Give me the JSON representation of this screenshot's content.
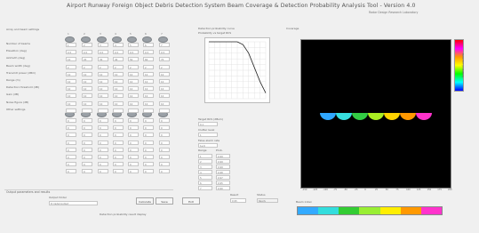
{
  "window": {
    "title": "Airport Runway Foreign Object Debris Detection System Beam Coverage & Detection Probability Analysis Tool - Version 4.0",
    "subtitle": "Radar Design Research Laboratory"
  },
  "left_panel": {
    "header": "Array and beam settings",
    "rows": [
      {
        "label": "Number of beams",
        "values": [
          "1",
          "2",
          "3",
          "4",
          "5",
          "6",
          "7",
          "8"
        ]
      },
      {
        "label": "Elevation (deg)",
        "values": [
          "0.5",
          "0.5",
          "0.5",
          "0.5",
          "0.5",
          "0.5",
          "0.5",
          "0.5"
        ]
      },
      {
        "label": "Azimuth (deg)",
        "values": [
          "10",
          "20",
          "30",
          "40",
          "50",
          "60",
          "70",
          "80"
        ]
      },
      {
        "label": "Beam width (deg)",
        "values": [
          "2",
          "2",
          "2",
          "2",
          "2",
          "2",
          "2",
          "2"
        ]
      },
      {
        "label": "Transmit power (dBm)",
        "values": [
          "10",
          "10",
          "10",
          "10",
          "10",
          "10",
          "10",
          "10"
        ]
      },
      {
        "label": "Range (m)",
        "values": [
          "10",
          "10",
          "10",
          "10",
          "10",
          "10",
          "10",
          "10"
        ]
      },
      {
        "label": "Detection threshold (dB)",
        "values": [
          "10",
          "10",
          "10",
          "10",
          "10",
          "10",
          "10",
          "10"
        ]
      },
      {
        "label": "Gain (dB)",
        "values": [
          "10",
          "10",
          "10",
          "10",
          "10",
          "10",
          "10",
          "10"
        ]
      },
      {
        "label": "Noise figure (dB)",
        "values": [
          "10",
          "10",
          "10",
          "10",
          "10",
          "10",
          "10",
          "10"
        ]
      },
      {
        "label": "Other settings",
        "values": [
          "",
          "",
          "",
          "",
          "",
          "",
          "",
          ""
        ]
      }
    ],
    "bottom_rows": [
      {
        "label": "",
        "values": [
          "0",
          "0",
          "0",
          "0",
          "0",
          "0",
          "0",
          "0"
        ]
      },
      {
        "label": "",
        "values": [
          "0",
          "0",
          "0",
          "0",
          "0",
          "0",
          "0",
          "0"
        ]
      },
      {
        "label": "",
        "values": [
          "0",
          "0",
          "0",
          "0",
          "0",
          "0",
          "0",
          "0"
        ]
      },
      {
        "label": "",
        "values": [
          "0",
          "0",
          "0",
          "0",
          "0",
          "0",
          "0",
          "0"
        ]
      },
      {
        "label": "",
        "values": [
          "0",
          "0",
          "0",
          "0",
          "0",
          "0",
          "0",
          "0"
        ]
      },
      {
        "label": "",
        "values": [
          "0",
          "0",
          "0",
          "0",
          "0",
          "0",
          "0",
          "0"
        ]
      },
      {
        "label": "",
        "values": [
          "0",
          "0",
          "0",
          "0",
          "0",
          "0",
          "0",
          "0"
        ]
      },
      {
        "label": "",
        "values": [
          "0",
          "0",
          "0",
          "0",
          "0",
          "0",
          "0",
          "0"
        ]
      }
    ],
    "col_headers": [
      "1",
      "2",
      "3",
      "4",
      "5",
      "6",
      "7",
      "8"
    ]
  },
  "bottom_left": {
    "section_label": "Output parameters and results",
    "path_label": "Output folder",
    "path_value": "D:\\radar\\output",
    "note": "Detection probability result display"
  },
  "buttons": {
    "calculate": "Calculate",
    "save": "Save",
    "exit": "Exit"
  },
  "middle": {
    "header": "Detection probability curve",
    "subheader": "Probability vs target RCS",
    "field_labels": [
      "Target RCS (dBsm)",
      "Clutter level",
      "False alarm rate"
    ],
    "field_values": [
      "0.1",
      "1",
      "1e-6"
    ],
    "small_labels": [
      "Range",
      "Prob."
    ],
    "small_values": [
      [
        "1",
        "0.99"
      ],
      [
        "2",
        "0.99"
      ],
      [
        "3",
        "0.99"
      ],
      [
        "4",
        "0.98"
      ],
      [
        "5",
        "0.97"
      ],
      [
        "6",
        "0.95"
      ],
      [
        "7",
        "0.90"
      ]
    ],
    "result_label": "Result",
    "result_value": "0.95",
    "extra_label": "Status",
    "extra_value": "Ready"
  },
  "right": {
    "plot_title": "Coverage",
    "colorbar_label": "Detection probability",
    "x_ticks": [
      "-150",
      "-125",
      "-100",
      "-75",
      "-50",
      "-25",
      "0",
      "25",
      "50",
      "75",
      "100",
      "125",
      "150",
      "175",
      "200"
    ],
    "legend_title": "Beam index",
    "legend_colors": [
      "#33aaff",
      "#33dddd",
      "#33cc33",
      "#99ee33",
      "#ffee00",
      "#ff9900",
      "#ff33cc"
    ]
  },
  "chart_data": {
    "type": "line",
    "title": "",
    "x": [
      0,
      1,
      2,
      3,
      4,
      5,
      6,
      7,
      8,
      9,
      10
    ],
    "series": [
      {
        "values": [
          1.0,
          1.0,
          1.0,
          1.0,
          1.0,
          1.0,
          0.95,
          0.8,
          0.55,
          0.3,
          0.1
        ]
      }
    ],
    "xlim": [
      0,
      10
    ],
    "ylim": [
      0,
      1
    ],
    "grid": true
  },
  "beams": {
    "colors": [
      "#2fa7ff",
      "#37e0e0",
      "#33cc44",
      "#aaee22",
      "#ffd400",
      "#ff9800",
      "#ff33cc"
    ]
  }
}
